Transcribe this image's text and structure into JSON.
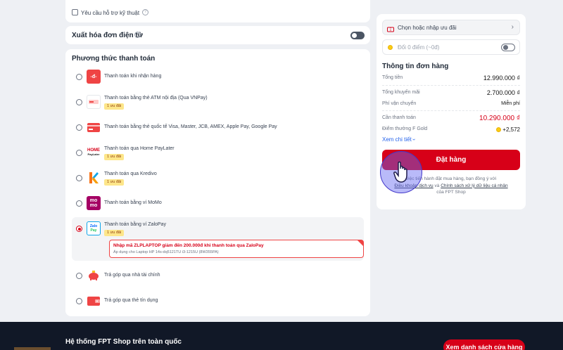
{
  "tech_support": {
    "label": "Yêu cầu hỗ trợ kỹ thuật"
  },
  "invoice": {
    "label": "Xuất hóa đơn điện tử"
  },
  "payment": {
    "title": "Phương thức thanh toán",
    "methods": [
      {
        "label": "Thanh toán khi nhận hàng",
        "badge": ""
      },
      {
        "label": "Thanh toán bằng thẻ ATM nội địa (Qua VNPay)",
        "badge": "1 ưu đãi"
      },
      {
        "label": "Thanh toán bằng thẻ quốc tế Visa, Master, JCB, AMEX, Apple Pay, Google Pay",
        "badge": ""
      },
      {
        "label": "Thanh toán qua Home PayLater",
        "badge": "1 ưu đãi"
      },
      {
        "label": "Thanh toán qua Kredivo",
        "badge": "1 ưu đãi"
      },
      {
        "label": "Thanh toán bằng ví MoMo",
        "badge": ""
      },
      {
        "label": "Thanh toán bằng ví ZaloPay",
        "badge": "1 ưu đãi"
      },
      {
        "label": "Trả góp qua nhà tài chính",
        "badge": ""
      },
      {
        "label": "Trả góp qua thẻ tín dụng",
        "badge": ""
      }
    ],
    "zalopay_promo": {
      "title": "Nhập mã ZLPLAPTOP giảm đến 200.000đ khi thanh toán qua ZaloPay",
      "desc": "Áp dụng cho Laptop HP 14s-dq5121TU i3-1215U (8W355PA)"
    },
    "logos": {
      "cod": "-đ-",
      "home_1": "HOME",
      "home_2": "PayLater",
      "momo_1": "mo",
      "momo_2": "mo",
      "zalo_1": "Zalo",
      "zalo_2": "Pay"
    }
  },
  "summary": {
    "voucher_label": "Chọn hoặc nhập ưu đãi",
    "points_label": "Đổi 0 điểm",
    "points_value": "(~0đ)",
    "title": "Thông tin đơn hàng",
    "total_label": "Tổng tiền",
    "total_value": "12.990.000 ₫",
    "discount_label": "Tổng khuyến mãi",
    "discount_value": "2.700.000 ₫",
    "shipping_label": "Phí vận chuyển",
    "shipping_value": "Miễn phí",
    "payable_label": "Cần thanh toán",
    "payable_value": "10.290.000 ₫",
    "gold_label": "Điểm thưởng F Gold",
    "gold_value": "+2,572",
    "details_link": "Xem chi tiết",
    "order_button": "Đặt hàng",
    "terms_1": "việc tiến hành đặt mua hàng, bạn đồng ý với",
    "terms_link1": "Điều khoản dịch vụ",
    "terms_and": "và",
    "terms_link2": "Chính sách xử lý dữ liệu cá nhân",
    "terms_2": "của FPT Shop"
  },
  "footer": {
    "title": "Hệ thống FPT Shop trên toàn quốc",
    "store_button": "Xem danh sách cửa hàng"
  }
}
